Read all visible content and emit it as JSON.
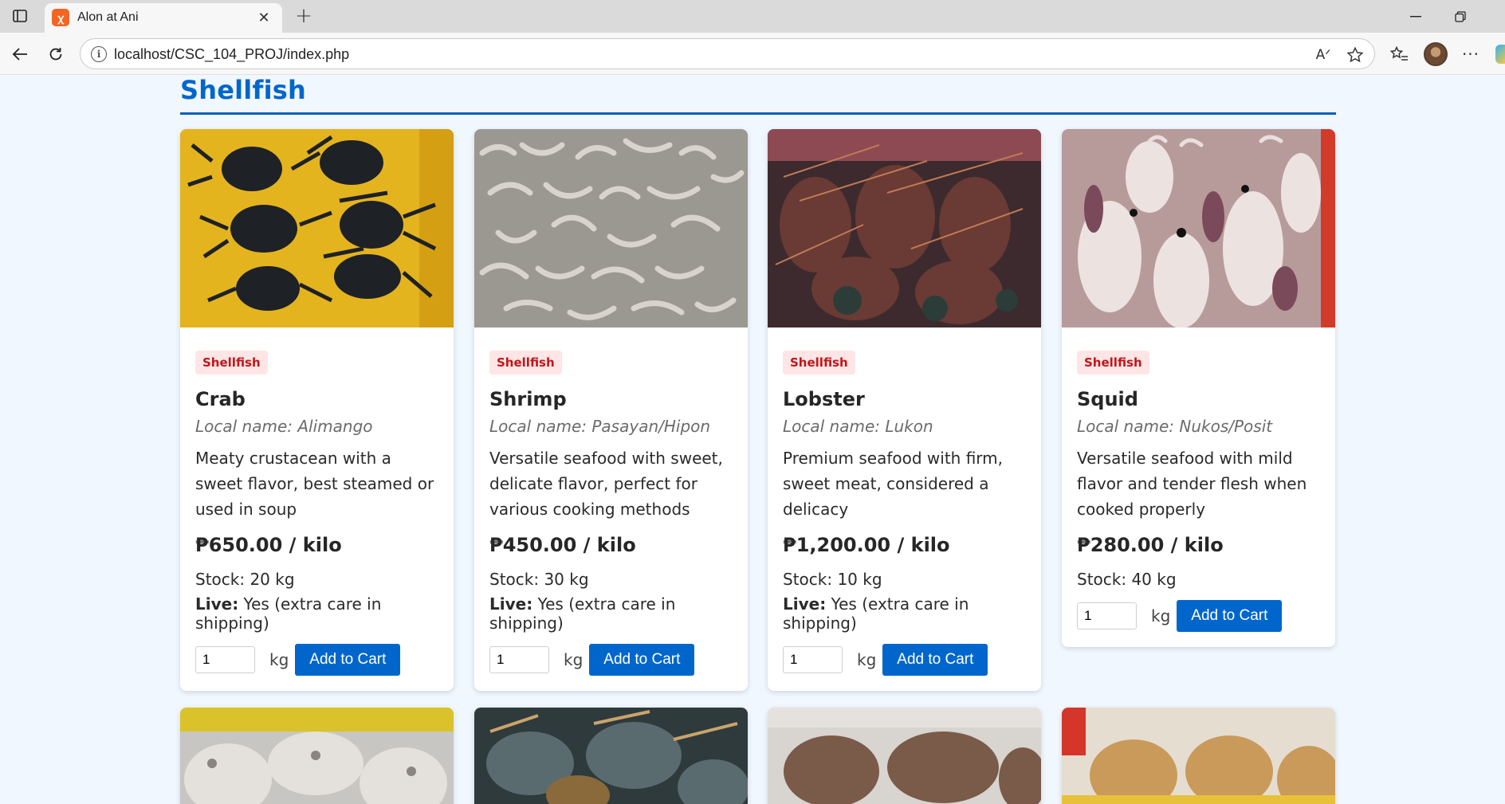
{
  "browser": {
    "tab_title": "Alon at Ani",
    "url": "localhost/CSC_104_PROJ/index.php"
  },
  "section": {
    "title": "Shellfish"
  },
  "products": [
    {
      "category": "Shellfish",
      "name": "Crab",
      "local_name": "Local name: Alimango",
      "description": "Meaty crustacean with a sweet flavor, best steamed or used in soup",
      "price": "₱650.00 / kilo",
      "stock": "Stock: 20 kg",
      "live_label": "Live:",
      "live_value": " Yes (extra care in shipping)",
      "quantity": "1",
      "unit": "kg",
      "button": "Add to Cart"
    },
    {
      "category": "Shellfish",
      "name": "Shrimp",
      "local_name": "Local name: Pasayan/Hipon",
      "description": "Versatile seafood with sweet, delicate flavor, perfect for various cooking methods",
      "price": "₱450.00 / kilo",
      "stock": "Stock: 30 kg",
      "live_label": "Live:",
      "live_value": " Yes (extra care in shipping)",
      "quantity": "1",
      "unit": "kg",
      "button": "Add to Cart"
    },
    {
      "category": "Shellfish",
      "name": "Lobster",
      "local_name": "Local name: Lukon",
      "description": "Premium seafood with firm, sweet meat, considered a delicacy",
      "price": "₱1,200.00 / kilo",
      "stock": "Stock: 10 kg",
      "live_label": "Live:",
      "live_value": " Yes (extra care in shipping)",
      "quantity": "1",
      "unit": "kg",
      "button": "Add to Cart"
    },
    {
      "category": "Shellfish",
      "name": "Squid",
      "local_name": "Local name: Nukos/Posit",
      "description": "Versatile seafood with mild flavor and tender flesh when cooked properly",
      "price": "₱280.00 / kilo",
      "stock": "Stock: 40 kg",
      "quantity": "1",
      "unit": "kg",
      "button": "Add to Cart"
    }
  ]
}
